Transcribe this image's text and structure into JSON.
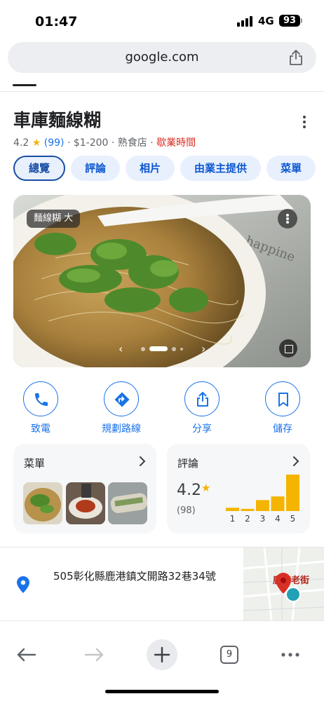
{
  "status": {
    "time": "01:47",
    "network": "4G",
    "battery": "93"
  },
  "browser": {
    "url": "google.com",
    "tab_count": "9"
  },
  "place": {
    "name": "車庫麵線糊",
    "rating": "4.2",
    "star": "★",
    "review_count": "(99)",
    "separator": "·",
    "price": "$1-200",
    "category": "熟食店",
    "hours_label": "歇業時間"
  },
  "chips": [
    "總覽",
    "評論",
    "相片",
    "由業主提供",
    "菜單"
  ],
  "photo": {
    "caption": "麵線糊 大",
    "prev": "‹",
    "next": "›"
  },
  "actions": [
    {
      "label": "致電",
      "icon": "phone-icon"
    },
    {
      "label": "規劃路線",
      "icon": "directions-icon"
    },
    {
      "label": "分享",
      "icon": "share-icon"
    },
    {
      "label": "儲存",
      "icon": "bookmark-icon"
    }
  ],
  "menu_card": {
    "title": "菜單"
  },
  "reviews_card": {
    "title": "評論",
    "rating": "4.2",
    "star": "★",
    "count": "(98)",
    "histogram_labels": [
      "1",
      "2",
      "3",
      "4",
      "5"
    ],
    "histogram_values": [
      0.09,
      0.06,
      0.3,
      0.4,
      1.0
    ]
  },
  "address": {
    "text": "505彰化縣鹿港鎮文開路32巷34號",
    "map_label": "鹿港老街"
  },
  "colors": {
    "accent": "#1a73e8",
    "star": "#f4b400",
    "closed": "#d93025",
    "bar": "#f4b400"
  }
}
